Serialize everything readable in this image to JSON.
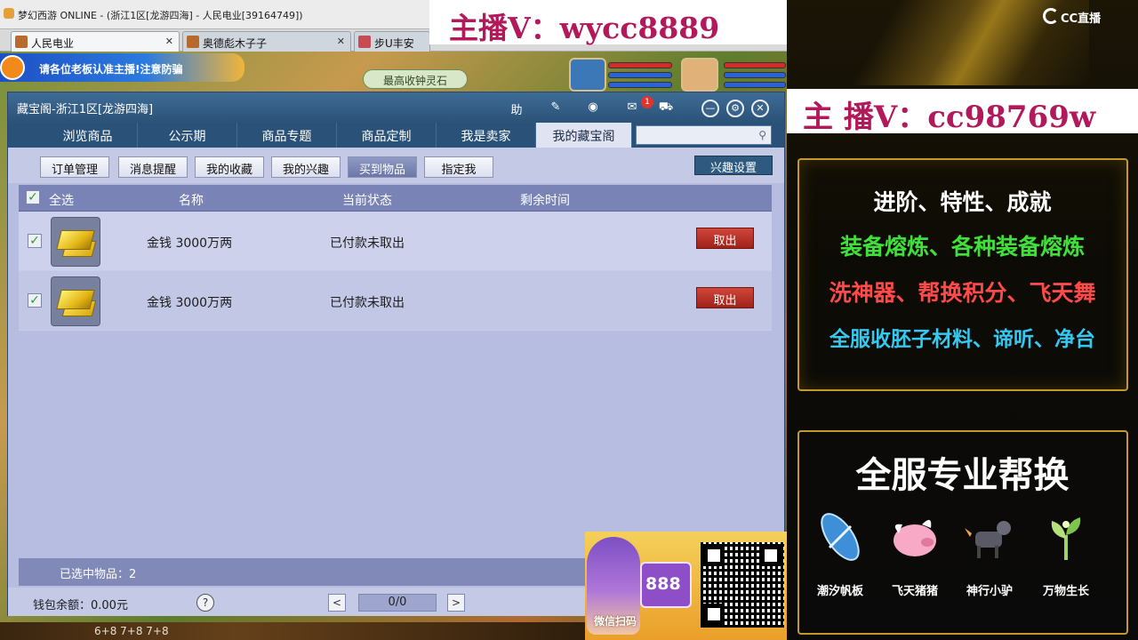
{
  "window": {
    "title": "梦幻西游 ONLINE - (浙江1区[龙游四海] - 人民电业[39164749])"
  },
  "browser_tabs": [
    {
      "label": "人民电业"
    },
    {
      "label": "奥德彪木子子"
    },
    {
      "label": "步U丰安"
    }
  ],
  "game_hud": {
    "banner_text": "请各位老板认准主播!注意防骗",
    "pill_text": "最高收钟灵石"
  },
  "overlay": {
    "top_wechat": "主播V：wycc8889",
    "promo_number": "888",
    "promo_scan": "微信扫码"
  },
  "dialog": {
    "title": "藏宝阁-浙江1区[龙游四海]",
    "header_buttons": {
      "help": "助"
    },
    "message_badge": "1",
    "nav_tabs": [
      "浏览商品",
      "公示期",
      "商品专题",
      "商品定制",
      "我是卖家",
      "我的藏宝阁"
    ],
    "search_placeholder": "",
    "sub_tabs": [
      "订单管理",
      "消息提醒",
      "我的收藏",
      "我的兴趣",
      "买到物品",
      "指定我"
    ],
    "interest_settings": "兴趣设置",
    "table": {
      "headers": [
        "全选",
        "名称",
        "当前状态",
        "剩余时间"
      ],
      "rows": [
        {
          "name": "金钱 3000万两",
          "status": "已付款未取出",
          "remaining": "",
          "action": "取出"
        },
        {
          "name": "金钱 3000万两",
          "status": "已付款未取出",
          "remaining": "",
          "action": "取出"
        }
      ]
    },
    "selected_count": "已选中物品：2",
    "wallet": "钱包余额：0.00元",
    "help_symbol": "?",
    "pagination": {
      "prev": "<",
      "value": "0/0",
      "next": ">"
    }
  },
  "bottom_strip": "6+8 7+8 7+8",
  "right_panel": {
    "logo": "CC直播",
    "wechat": "主 播V：cc98769w",
    "services": [
      {
        "text": "进阶、特性、成就",
        "color": "#ffffff"
      },
      {
        "text": "装备熔炼、各种装备熔炼",
        "color": "#3fe03a"
      },
      {
        "text": "洗神器、帮换积分、飞天舞",
        "color": "#ff4a4a"
      },
      {
        "text": "全服收胚子材料、谛听、净台",
        "color": "#35c8f0"
      }
    ],
    "big_title": "全服专业帮换",
    "pets": [
      {
        "label": "潮汐帆板",
        "icon": "surfboard-icon"
      },
      {
        "label": "飞天猪猪",
        "icon": "flying-pig-icon"
      },
      {
        "label": "神行小驴",
        "icon": "donkey-icon"
      },
      {
        "label": "万物生长",
        "icon": "sprout-icon"
      }
    ]
  }
}
